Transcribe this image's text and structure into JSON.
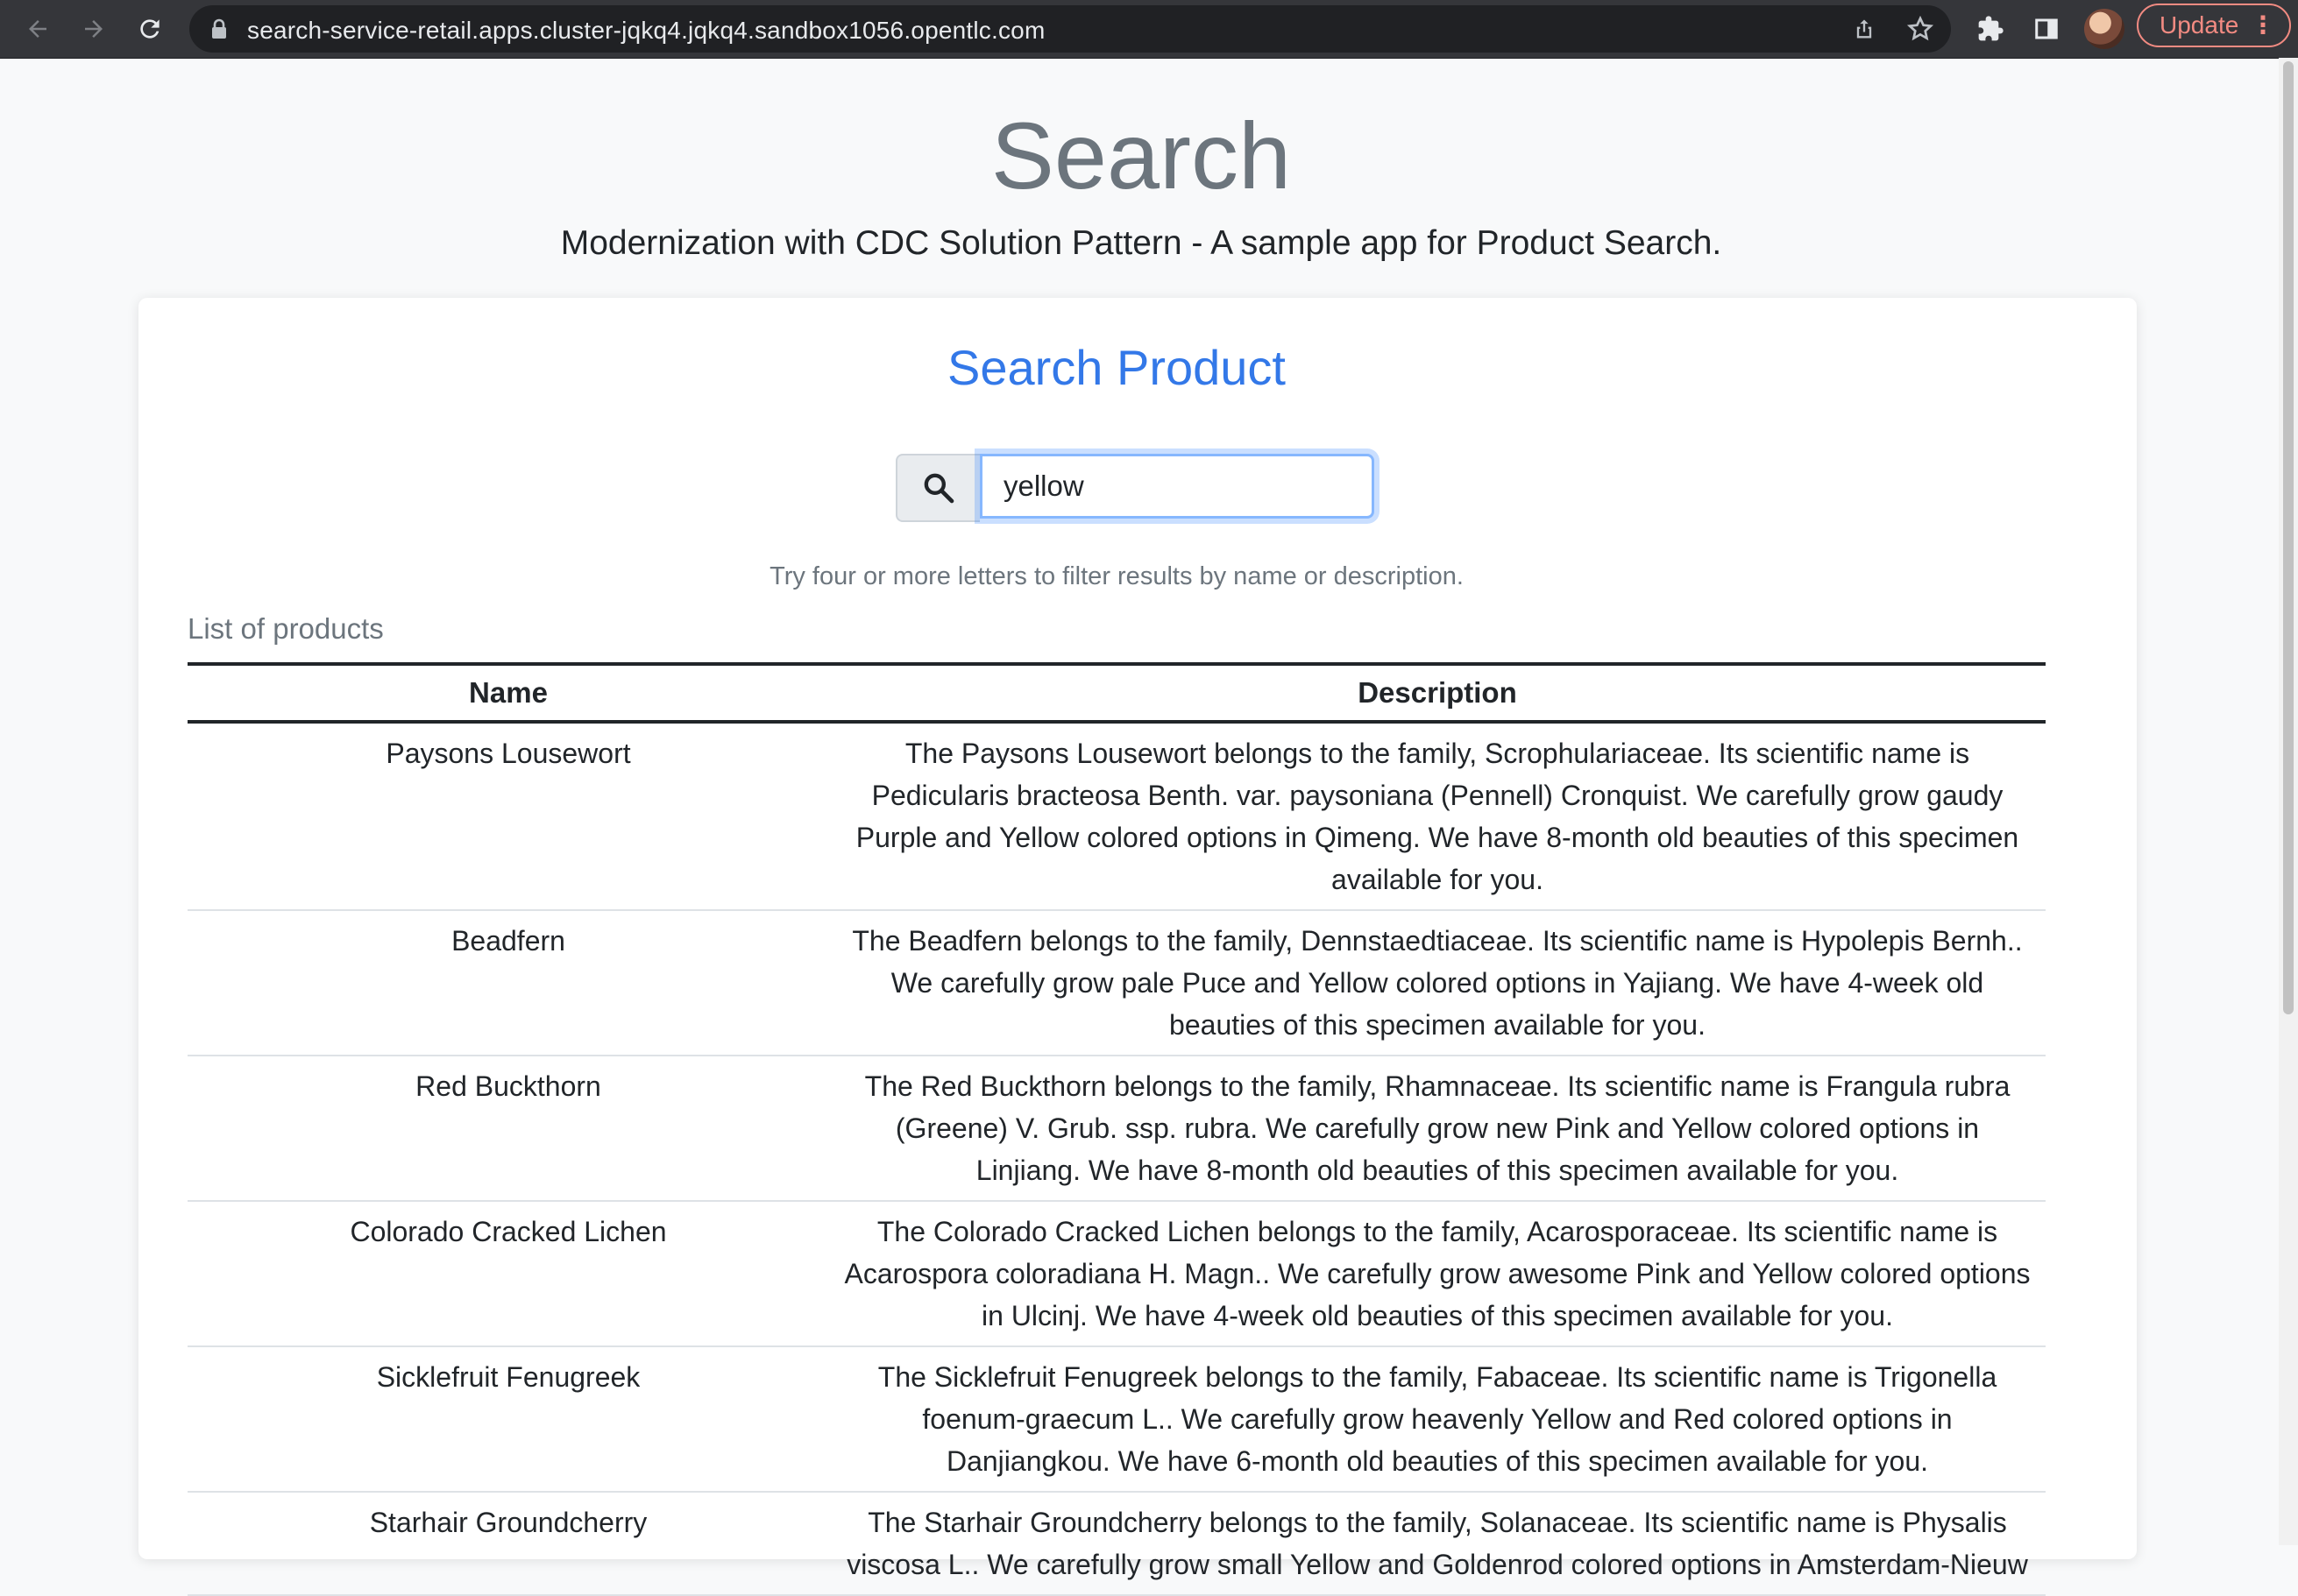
{
  "browser": {
    "url": "search-service-retail.apps.cluster-jqkq4.jqkq4.sandbox1056.opentlc.com",
    "update_label": "Update",
    "menu_glyph": "⋮"
  },
  "page": {
    "title": "Search",
    "subtitle": "Modernization with CDC Solution Pattern - A sample app for Product Search."
  },
  "card": {
    "title": "Search Product",
    "search_value": "yellow",
    "helper_text": "Try four or more letters to filter results by name or description.",
    "list_caption": "List of products",
    "headers": {
      "name": "Name",
      "description": "Description"
    },
    "rows": [
      {
        "name": "Paysons Lousewort",
        "description": "The Paysons Lousewort belongs to the family, Scrophulariaceae. Its scientific name is Pedicularis bracteosa Benth. var. paysoniana (Pennell) Cronquist. We carefully grow gaudy Purple and Yellow colored options in Qimeng. We have 8-month old beauties of this specimen available for you."
      },
      {
        "name": "Beadfern",
        "description": "The Beadfern belongs to the family, Dennstaedtiaceae. Its scientific name is Hypolepis Bernh.. We carefully grow pale Puce and Yellow colored options in Yajiang. We have 4-week old beauties of this specimen available for you."
      },
      {
        "name": "Red Buckthorn",
        "description": "The Red Buckthorn belongs to the family, Rhamnaceae. Its scientific name is Frangula rubra (Greene) V. Grub. ssp. rubra. We carefully grow new Pink and Yellow colored options in Linjiang. We have 8-month old beauties of this specimen available for you."
      },
      {
        "name": "Colorado Cracked Lichen",
        "description": "The Colorado Cracked Lichen belongs to the family, Acarosporaceae. Its scientific name is Acarospora coloradiana H. Magn.. We carefully grow awesome Pink and Yellow colored options in Ulcinj. We have 4-week old beauties of this specimen available for you."
      },
      {
        "name": "Sicklefruit Fenugreek",
        "description": "The Sicklefruit Fenugreek belongs to the family, Fabaceae. Its scientific name is Trigonella foenum-graecum L.. We carefully grow heavenly Yellow and Red colored options in Danjiangkou. We have 6-month old beauties of this specimen available for you."
      },
      {
        "name": "Starhair Groundcherry",
        "description": "The Starhair Groundcherry belongs to the family, Solanaceae. Its scientific name is Physalis viscosa L.. We carefully grow small Yellow and Goldenrod colored options in Amsterdam-Nieuw"
      }
    ]
  },
  "icons": {
    "back": "back-arrow-icon",
    "forward": "forward-arrow-icon",
    "reload": "reload-icon",
    "lock": "lock-icon",
    "share": "share-icon",
    "bookmark": "star-icon",
    "extensions": "puzzle-icon",
    "sidepanel": "side-panel-icon",
    "search": "search-icon"
  },
  "colors": {
    "accent": "#3378e8",
    "chrome_bg": "#35363a",
    "update": "#f28b82"
  }
}
